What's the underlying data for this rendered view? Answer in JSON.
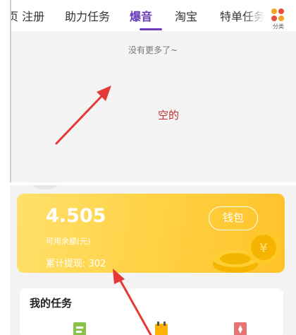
{
  "top_panel": {
    "tabs": [
      {
        "label": "页 注册",
        "active": false
      },
      {
        "label": "助力任务",
        "active": false
      },
      {
        "label": "爆音",
        "active": true
      },
      {
        "label": "淘宝",
        "active": false
      },
      {
        "label": "特单任务",
        "active": false
      }
    ],
    "category_button": {
      "label": "分类",
      "icon": "category-grid-icon"
    },
    "no_more_text": "没有更多了~",
    "annotation": "空的"
  },
  "bottom_panel": {
    "wallet": {
      "balance": "4.505",
      "balance_label": "可用余额(元)",
      "withdrawn_text": "累计提现: 302",
      "wallet_button": "钱包"
    },
    "tasks": {
      "title": "我的任务",
      "icons": [
        "checkin-task-icon",
        "daily-task-icon",
        "gift-task-icon"
      ]
    }
  },
  "colors": {
    "accent": "#6a3cbd",
    "annotation_red": "#e53935",
    "wallet_gold": "#ffd245"
  }
}
